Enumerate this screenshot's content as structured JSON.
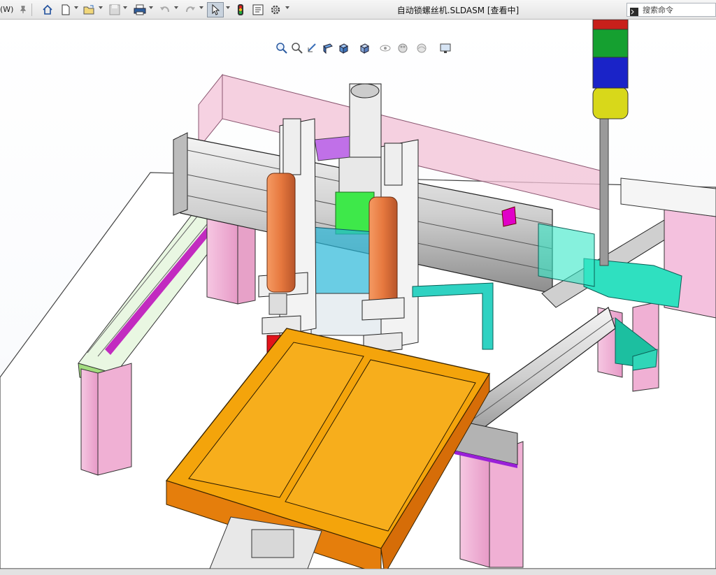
{
  "window": {
    "title": "自动锁螺丝机.SLDASM [查看中]",
    "menu_fragment": "(W)"
  },
  "toolbar": {
    "items": [
      "pin-icon",
      "home-icon",
      "new-icon",
      "open-icon",
      "save-icon",
      "print-icon",
      "undo-icon",
      "redo-icon",
      "select-icon",
      "rebuild-icon",
      "file-properties-icon",
      "options-icon"
    ]
  },
  "search": {
    "placeholder": "搜索命令"
  },
  "view_toolbar": {
    "items": [
      "zoom-to-fit-icon",
      "zoom-to-area-icon",
      "previous-view-icon",
      "section-view-icon",
      "view-orientation-icon",
      "display-style-icon",
      "hide-show-items-icon",
      "edit-appearance-icon",
      "apply-scene-icon",
      "view-settings-icon"
    ]
  },
  "colors": {
    "orange_plate": "#f4a40b",
    "pink_leg": "#f2b3d6",
    "cyan_block": "#2fe0c0",
    "tower_red": "#c8201b",
    "tower_green": "#15a030",
    "tower_blue": "#1a23c8",
    "tower_yellow": "#d8d81a",
    "screwdriver_orange": "#e6783e"
  }
}
